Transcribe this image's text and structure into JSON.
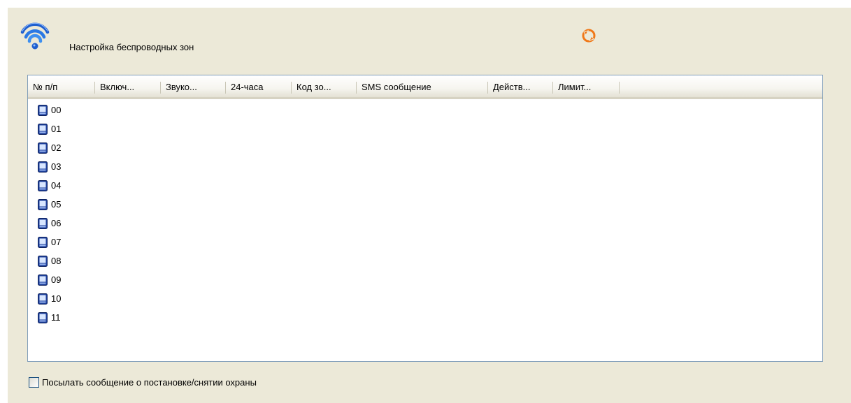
{
  "header": {
    "title": "Настройка беспроводных зон"
  },
  "table": {
    "columns": [
      "№ п/п",
      "Включ...",
      "Звуко...",
      "24-часа",
      "Код зо...",
      "SMS сообщение",
      "Действ...",
      "Лимит..."
    ],
    "rows": [
      "00",
      "01",
      "02",
      "03",
      "04",
      "05",
      "06",
      "07",
      "08",
      "09",
      "10",
      "11"
    ]
  },
  "options": {
    "send_message_label": "Посылать сообщение о постановке/снятии охраны",
    "send_message_checked": false
  },
  "icons": {
    "title_icon": "wifi-icon",
    "refresh_icon": "refresh-icon",
    "row_icon": "zone-device-icon"
  },
  "colors": {
    "panel_bg": "#ece9d8",
    "list_border": "#7f9db9",
    "accent_orange": "#f07818",
    "wifi_blue": "#1f5fcf"
  }
}
